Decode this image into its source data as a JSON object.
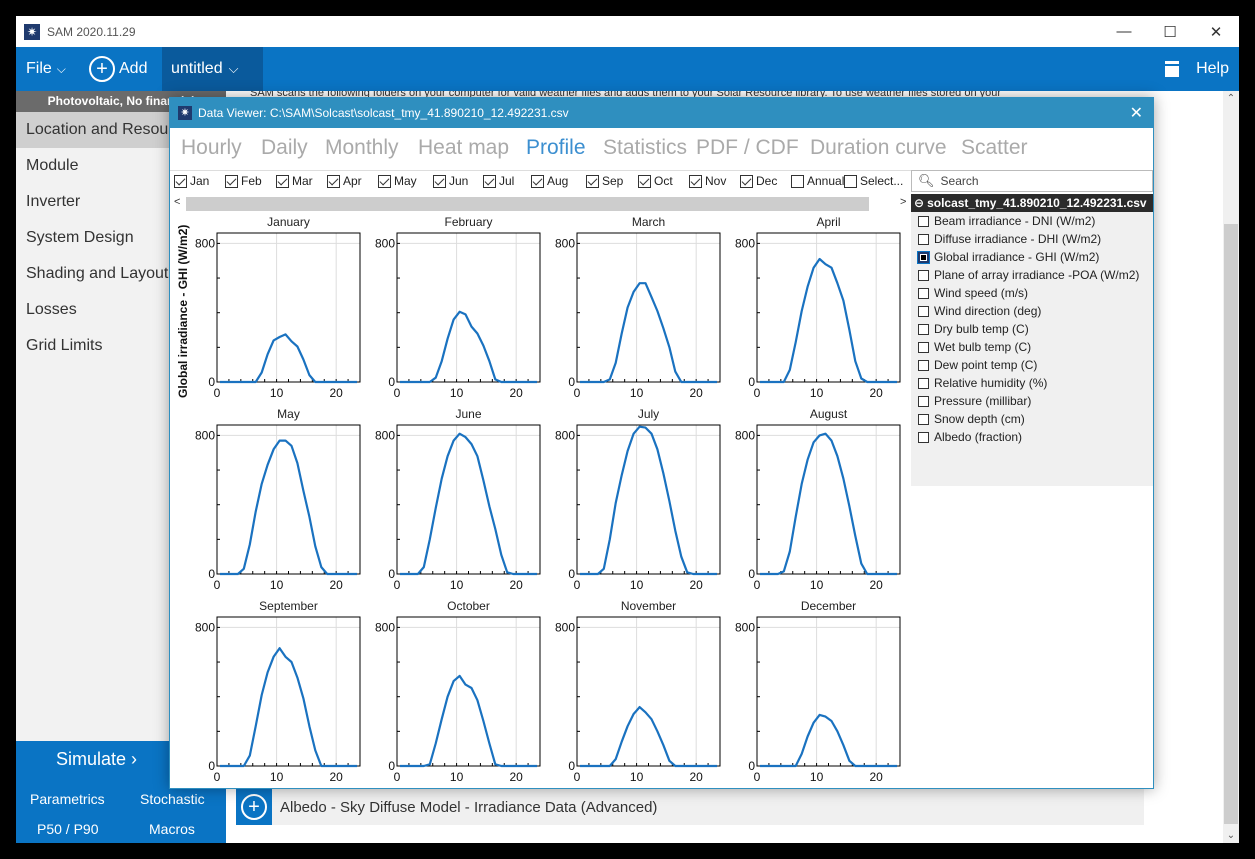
{
  "app": {
    "title": "SAM 2020.11.29"
  },
  "window_controls": {
    "minimize": "—",
    "maximize": "☐",
    "close": "✕"
  },
  "menubar": {
    "file": "File",
    "add": "Add",
    "case_name": "untitled",
    "help": "Help"
  },
  "sidebar": {
    "config": "Photovoltaic, No financial",
    "items": [
      "Location and Resource",
      "Module",
      "Inverter",
      "System Design",
      "Shading and Layout",
      "Losses",
      "Grid Limits"
    ],
    "active_index": 0
  },
  "simulate": {
    "label": "Simulate ›",
    "parametrics": "Parametrics",
    "stochastic": "Stochastic",
    "p50": "P50 / P90",
    "macros": "Macros"
  },
  "main": {
    "scan_text": "SAM scans the following folders on your computer for valid weather files and adds them to your Solar Resource library. To use weather files stored on your",
    "albedo_section": "Albedo - Sky Diffuse Model - Irradiance Data (Advanced)"
  },
  "data_viewer": {
    "title": "Data Viewer: C:\\SAM\\Solcast\\solcast_tmy_41.890210_12.492231.csv",
    "tabs": [
      "Hourly",
      "Daily",
      "Monthly",
      "Heat map",
      "Profile",
      "Statistics",
      "PDF / CDF",
      "Duration curve",
      "Scatter"
    ],
    "active_tab": "Profile",
    "month_checks": [
      {
        "label": "Jan",
        "checked": true
      },
      {
        "label": "Feb",
        "checked": true
      },
      {
        "label": "Mar",
        "checked": true
      },
      {
        "label": "Apr",
        "checked": true
      },
      {
        "label": "May",
        "checked": true
      },
      {
        "label": "Jun",
        "checked": true
      },
      {
        "label": "Jul",
        "checked": true
      },
      {
        "label": "Aug",
        "checked": true
      },
      {
        "label": "Sep",
        "checked": true
      },
      {
        "label": "Oct",
        "checked": true
      },
      {
        "label": "Nov",
        "checked": true
      },
      {
        "label": "Dec",
        "checked": true
      },
      {
        "label": "Annual",
        "checked": false
      },
      {
        "label": "Select...",
        "checked": false
      }
    ],
    "search_placeholder": "Search",
    "file_name": "solcast_tmy_41.890210_12.492231.csv",
    "variables": [
      {
        "label": "Beam irradiance - DNI (W/m2)",
        "checked": false
      },
      {
        "label": "Diffuse irradiance - DHI (W/m2)",
        "checked": false
      },
      {
        "label": "Global irradiance - GHI (W/m2)",
        "checked": true
      },
      {
        "label": "Plane of array irradiance -POA (W/m2)",
        "checked": false
      },
      {
        "label": "Wind speed (m/s)",
        "checked": false
      },
      {
        "label": "Wind direction (deg)",
        "checked": false
      },
      {
        "label": "Dry bulb temp (C)",
        "checked": false
      },
      {
        "label": "Wet bulb temp (C)",
        "checked": false
      },
      {
        "label": "Dew point temp (C)",
        "checked": false
      },
      {
        "label": "Relative humidity (%)",
        "checked": false
      },
      {
        "label": "Pressure (millibar)",
        "checked": false
      },
      {
        "label": "Snow depth (cm)",
        "checked": false
      },
      {
        "label": "Albedo (fraction)",
        "checked": false
      }
    ]
  },
  "chart_data": {
    "type": "line",
    "ylabel": "Global irradiance - GHI (W/m2)",
    "xlabel": "",
    "xlim": [
      0,
      24
    ],
    "ylim": [
      0,
      860
    ],
    "xticks": [
      0,
      10,
      20
    ],
    "yticks": [
      0,
      800
    ],
    "line_color": "#1a72c0",
    "grid": true,
    "x": [
      0.5,
      1.5,
      2.5,
      3.5,
      4.5,
      5.5,
      6.5,
      7.5,
      8.5,
      9.5,
      10.5,
      11.5,
      12.5,
      13.5,
      14.5,
      15.5,
      16.5,
      17.5,
      18.5,
      19.5,
      20.5,
      21.5,
      22.5,
      23.5
    ],
    "series": [
      {
        "name": "January",
        "values": [
          0,
          0,
          0,
          0,
          0,
          0,
          0,
          55,
          160,
          240,
          260,
          275,
          235,
          205,
          130,
          40,
          0,
          0,
          0,
          0,
          0,
          0,
          0,
          0
        ]
      },
      {
        "name": "February",
        "values": [
          0,
          0,
          0,
          0,
          0,
          0,
          25,
          120,
          250,
          360,
          405,
          390,
          320,
          280,
          210,
          120,
          15,
          0,
          0,
          0,
          0,
          0,
          0,
          0
        ]
      },
      {
        "name": "March",
        "values": [
          0,
          0,
          0,
          0,
          0,
          15,
          110,
          280,
          430,
          520,
          570,
          570,
          490,
          410,
          310,
          200,
          60,
          0,
          0,
          0,
          0,
          0,
          0,
          0
        ]
      },
      {
        "name": "April",
        "values": [
          0,
          0,
          0,
          0,
          0,
          70,
          230,
          410,
          550,
          660,
          710,
          680,
          660,
          570,
          470,
          300,
          120,
          20,
          0,
          0,
          0,
          0,
          0,
          0
        ]
      },
      {
        "name": "May",
        "values": [
          0,
          0,
          0,
          0,
          30,
          170,
          360,
          520,
          630,
          720,
          770,
          770,
          740,
          640,
          480,
          330,
          160,
          40,
          0,
          0,
          0,
          0,
          0,
          0
        ]
      },
      {
        "name": "June",
        "values": [
          0,
          0,
          0,
          0,
          40,
          200,
          380,
          550,
          680,
          770,
          810,
          790,
          750,
          680,
          540,
          390,
          260,
          110,
          10,
          0,
          0,
          0,
          0,
          0
        ]
      },
      {
        "name": "July",
        "values": [
          0,
          0,
          0,
          0,
          30,
          200,
          410,
          570,
          710,
          810,
          850,
          845,
          810,
          720,
          580,
          420,
          250,
          100,
          10,
          0,
          0,
          0,
          0,
          0
        ]
      },
      {
        "name": "August",
        "values": [
          0,
          0,
          0,
          0,
          15,
          130,
          330,
          520,
          660,
          760,
          800,
          810,
          770,
          680,
          550,
          390,
          220,
          60,
          0,
          0,
          0,
          0,
          0,
          0
        ]
      },
      {
        "name": "September",
        "values": [
          0,
          0,
          0,
          0,
          0,
          60,
          230,
          410,
          540,
          630,
          680,
          630,
          600,
          510,
          390,
          230,
          90,
          0,
          0,
          0,
          0,
          0,
          0,
          0
        ]
      },
      {
        "name": "October",
        "values": [
          0,
          0,
          0,
          0,
          0,
          10,
          130,
          270,
          400,
          490,
          520,
          470,
          450,
          380,
          260,
          130,
          10,
          0,
          0,
          0,
          0,
          0,
          0,
          0
        ]
      },
      {
        "name": "November",
        "values": [
          0,
          0,
          0,
          0,
          0,
          0,
          40,
          140,
          230,
          300,
          340,
          310,
          270,
          200,
          120,
          30,
          0,
          0,
          0,
          0,
          0,
          0,
          0,
          0
        ]
      },
      {
        "name": "December",
        "values": [
          0,
          0,
          0,
          0,
          0,
          0,
          0,
          70,
          170,
          250,
          295,
          285,
          260,
          200,
          120,
          30,
          0,
          0,
          0,
          0,
          0,
          0,
          0,
          0
        ]
      }
    ]
  }
}
